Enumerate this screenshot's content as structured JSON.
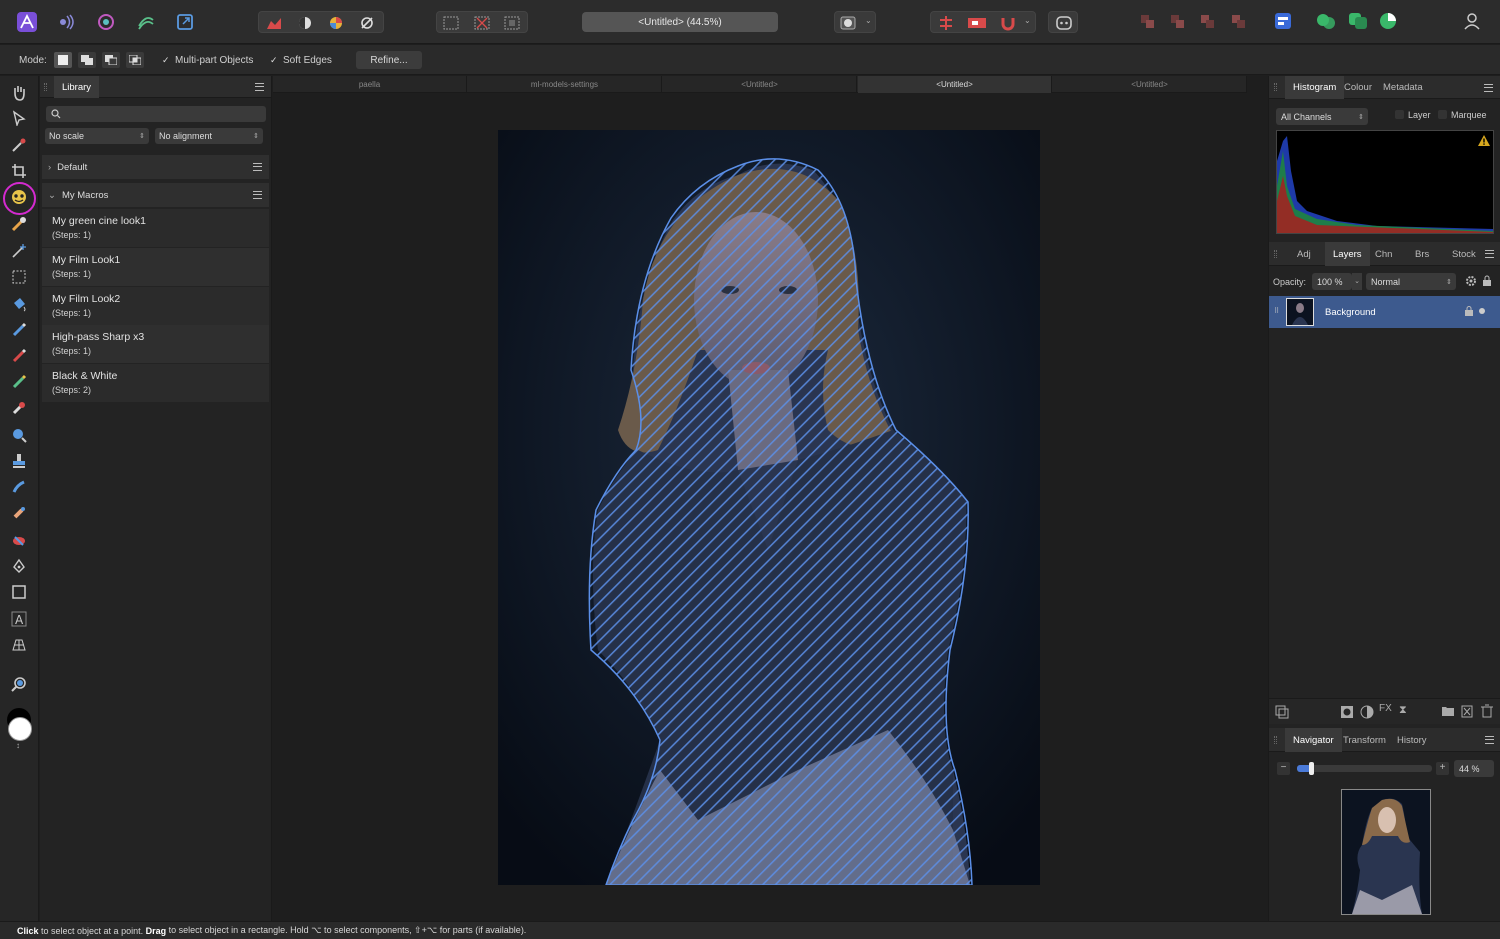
{
  "document": {
    "title": "<Untitled> (44.5%)"
  },
  "context_bar": {
    "mode_label": "Mode:",
    "multipart_label": "Multi-part Objects",
    "soft_edges_label": "Soft Edges",
    "refine_label": "Refine..."
  },
  "library": {
    "tab_label": "Library",
    "scale_select": "No scale",
    "alignment_select": "No alignment",
    "categories": [
      {
        "label": "Default",
        "expanded": false
      },
      {
        "label": "My Macros",
        "expanded": true
      }
    ],
    "macros": [
      {
        "name": "My green cine look1",
        "steps": "(Steps: 1)"
      },
      {
        "name": "My Film Look1",
        "steps": "(Steps: 1)"
      },
      {
        "name": "My Film Look2",
        "steps": "(Steps: 1)"
      },
      {
        "name": "High-pass Sharp x3",
        "steps": "(Steps: 1)"
      },
      {
        "name": "Black & White",
        "steps": "(Steps: 2)"
      }
    ]
  },
  "doc_tabs": [
    "paella",
    "ml-models-settings",
    "<Untitled>",
    "<Untitled>",
    "<Untitled>"
  ],
  "histogram_panel": {
    "tabs": [
      "Histogram",
      "Colour",
      "Metadata"
    ],
    "channels": "All Channels",
    "layer_label": "Layer",
    "marquee_label": "Marquee"
  },
  "layers_panel": {
    "tabs": [
      "Adj",
      "Layers",
      "Chn",
      "Brs",
      "Stock"
    ],
    "opacity_label": "Opacity:",
    "opacity_value": "100 %",
    "blend_mode": "Normal",
    "layers": [
      {
        "name": "Background"
      }
    ]
  },
  "navigator_panel": {
    "tabs": [
      "Navigator",
      "Transform",
      "History"
    ],
    "zoom_value": "44 %",
    "zoom_fraction": 0.1
  },
  "status": {
    "click": "Click",
    "t1": " to select object at a point. ",
    "drag": "Drag",
    "t2": " to select object in a rectangle. Hold ⌥ to select components, ⇧+⌥ for parts (if available)."
  },
  "colors": {
    "accent": "#3f6fcf",
    "highlight_ring": "#d42ad0",
    "selection": "#5b8fe8"
  },
  "icons": [
    "hand-tool-icon",
    "move-tool-icon",
    "color-picker-icon",
    "crop-icon",
    "selection-brush-icon",
    "flood-select-icon",
    "marquee-icon",
    "paint-brush-icon",
    "dodge-icon",
    "zoom-icon",
    "text-tool-icon",
    "layers-mask-icon"
  ]
}
